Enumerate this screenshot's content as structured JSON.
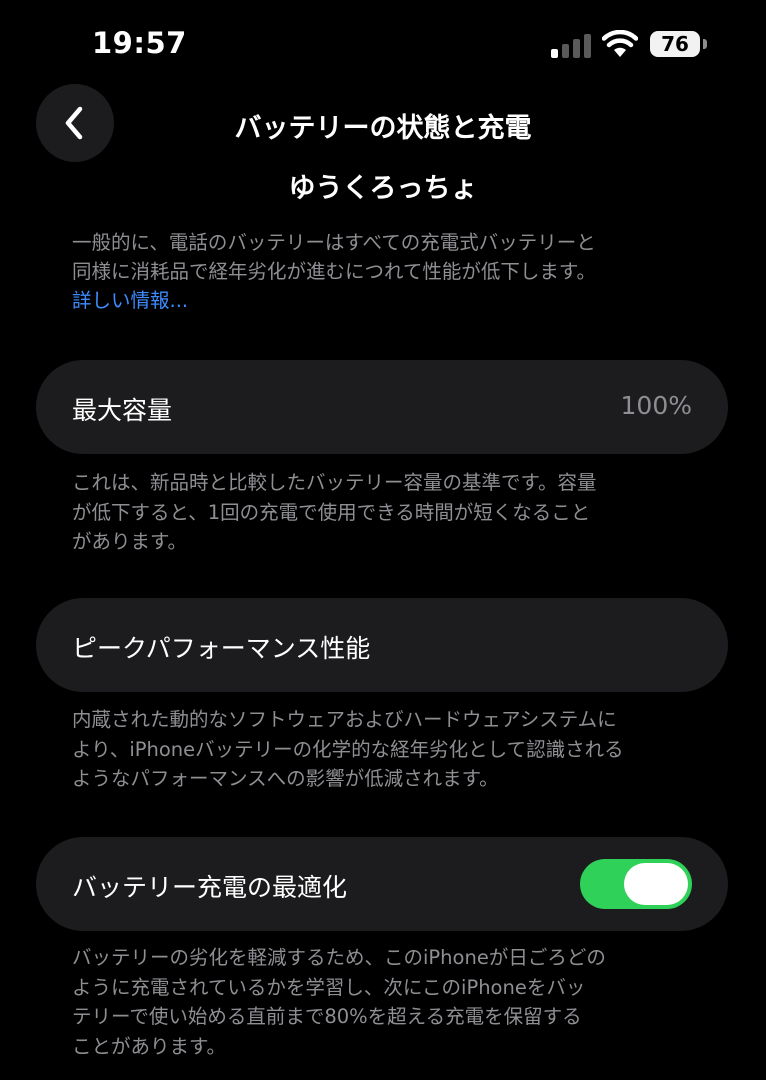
{
  "status_bar": {
    "time": "19:57",
    "battery_level": "76",
    "signal_icon": "cellular-signal-icon",
    "wifi_icon": "wifi-icon"
  },
  "nav": {
    "back_icon": "chevron-left-icon",
    "title": "バッテリーの状態と充電"
  },
  "watermark": "ゆうくろっちょ",
  "intro": {
    "lines": [
      "一般的に、電話のバッテリーはすべての充電式バッテリーと",
      "同様に消耗品で経年劣化が進むにつれて性能が低下します。"
    ],
    "learn_more": "詳しい情報..."
  },
  "max_capacity": {
    "label": "最大容量",
    "value": "100%",
    "description": [
      "これは、新品時と比較したバッテリー容量の基準です。容量",
      "が低下すると、1回の充電で使用できる時間が短くなること",
      "があります。"
    ]
  },
  "peak_performance": {
    "label": "ピークパフォーマンス性能",
    "description": [
      "内蔵された動的なソフトウェアおよびハードウェアシステムに",
      "より、iPhoneバッテリーの化学的な経年劣化として認識される",
      "ようなパフォーマンスへの影響が低減されます。"
    ]
  },
  "optimized_charging": {
    "label": "バッテリー充電の最適化",
    "enabled": true,
    "description": [
      "バッテリーの劣化を軽減するため、このiPhoneが日ごろどの",
      "ように充電されているかを学習し、次にこのiPhoneをバッ",
      "テリーで使い始める直前まで80%を超える充電を保留する",
      "ことがあります。"
    ]
  },
  "colors": {
    "background": "#000000",
    "card": "#1c1c1e",
    "secondary_text": "#8e8e93",
    "link": "#3e8bff",
    "toggle_on": "#30d158"
  }
}
